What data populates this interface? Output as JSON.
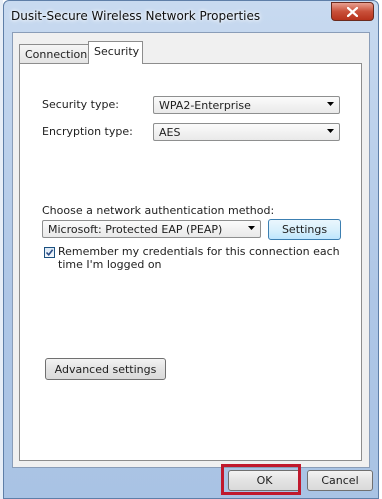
{
  "window": {
    "title": "Dusit-Secure Wireless Network Properties"
  },
  "tabs": [
    {
      "label": "Connection",
      "selected": false
    },
    {
      "label": "Security",
      "selected": true
    }
  ],
  "security": {
    "security_type_label": "Security type:",
    "security_type_value": "WPA2-Enterprise",
    "encryption_type_label": "Encryption type:",
    "encryption_type_value": "AES",
    "auth_method_label": "Choose a network authentication method:",
    "auth_method_value": "Microsoft: Protected EAP (PEAP)",
    "settings_label": "Settings",
    "remember_label_line1": "Remember my credentials for this connection each",
    "remember_label_line2": "time I'm logged on",
    "remember_checked": true,
    "advanced_label": "Advanced settings"
  },
  "footer": {
    "ok_label": "OK",
    "cancel_label": "Cancel"
  },
  "colors": {
    "highlight": "#c0192d",
    "close_button": "#c9503a"
  }
}
